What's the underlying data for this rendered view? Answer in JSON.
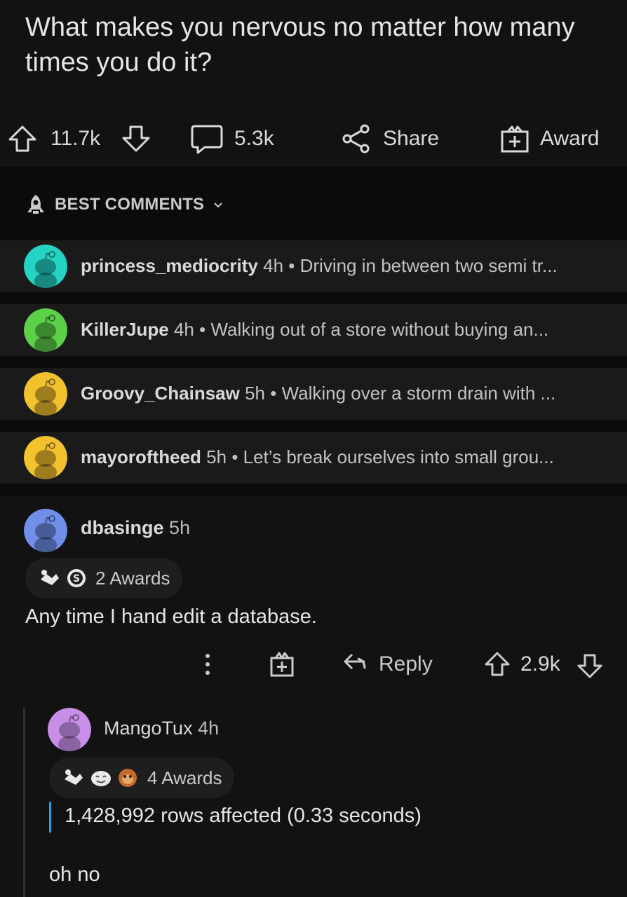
{
  "post": {
    "title": "What makes you nervous no matter how many times you do it?",
    "upvotes": "11.7k",
    "comments": "5.3k",
    "share_label": "Share",
    "award_label": "Award"
  },
  "sort": {
    "label": "BEST COMMENTS"
  },
  "collapsed_comments": [
    {
      "user": "princess_mediocrity",
      "time": "4h",
      "snippet": "Driving in between two semi tr...",
      "avatar_color": "#24d3c3"
    },
    {
      "user": "KillerJupe",
      "time": "4h",
      "snippet": "Walking out of a store without buying an...",
      "avatar_color": "#5dd04a"
    },
    {
      "user": "Groovy_Chainsaw",
      "time": "5h",
      "snippet": "Walking over a storm drain with ...",
      "avatar_color": "#f2c12e"
    },
    {
      "user": "mayoroftheed",
      "time": "5h",
      "snippet": "Let’s break ourselves into small grou...",
      "avatar_color": "#f2c12e"
    }
  ],
  "comment": {
    "user": "dbasinge",
    "time": "5h",
    "awards": "2 Awards",
    "body": "Any time I hand edit a database.",
    "reply_label": "Reply",
    "score": "2.9k",
    "avatar_color": "#6f8fe8"
  },
  "reply": {
    "user": "MangoTux",
    "time": "4h",
    "awards": "4 Awards",
    "quote": "1,428,992 rows affected (0.33 seconds)",
    "body": "oh no",
    "avatar_color": "#c98ee8"
  },
  "colors": {
    "background": "#121212",
    "row": "#1a1a1b",
    "quote_bar": "#24a0ed"
  }
}
